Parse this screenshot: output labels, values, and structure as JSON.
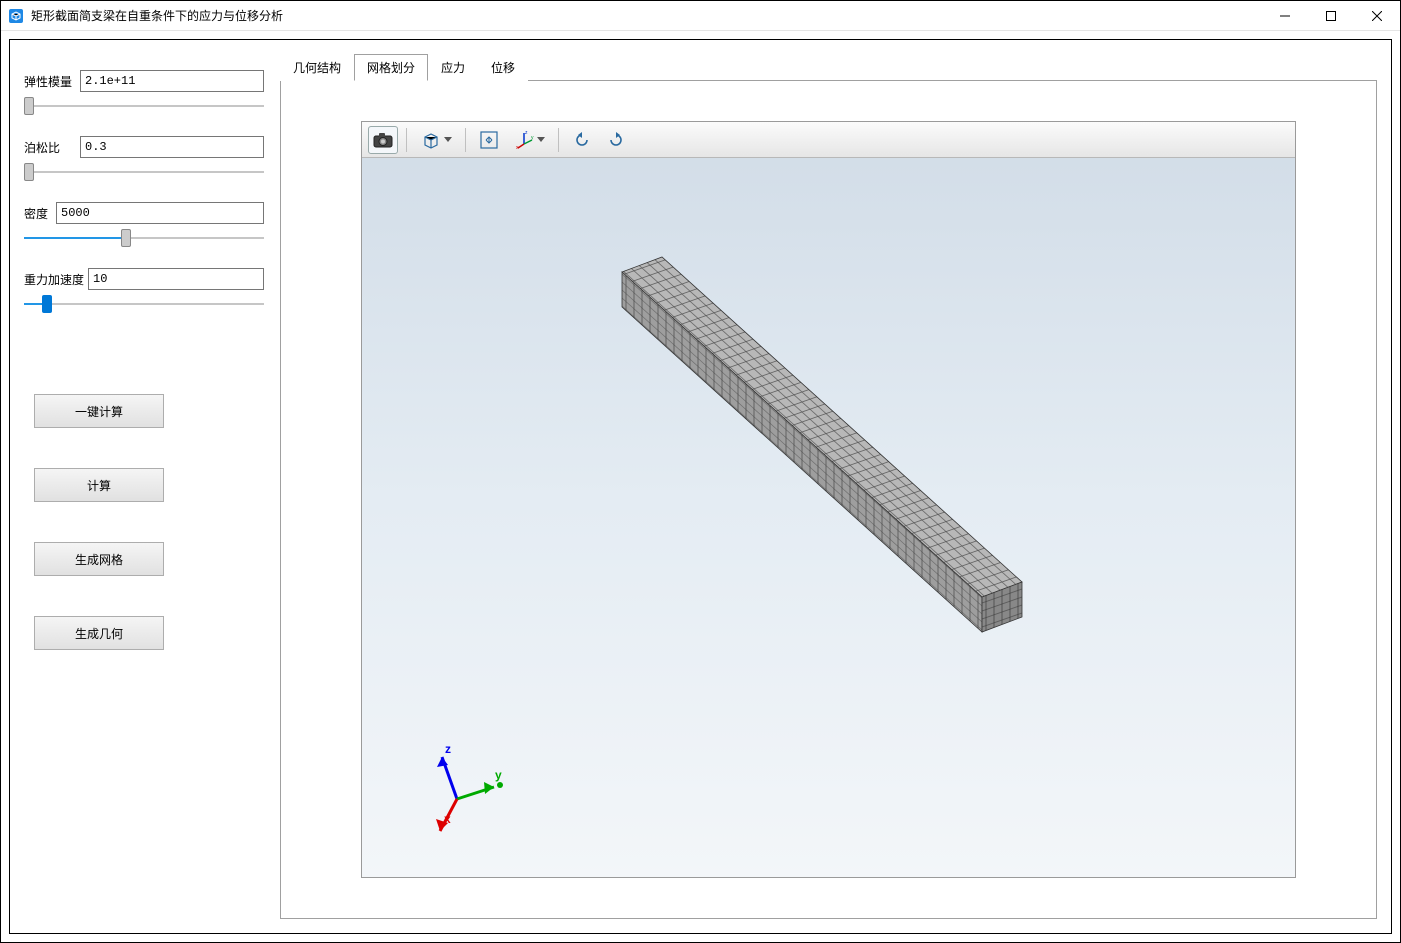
{
  "window": {
    "title": "矩形截面简支梁在自重条件下的应力与位移分析"
  },
  "params": {
    "elastic_modulus": {
      "label": "弹性模量",
      "value": "2.1e+11",
      "slider_pct": 0
    },
    "poisson_ratio": {
      "label": "泊松比",
      "value": "0.3",
      "slider_pct": 0
    },
    "density": {
      "label": "密度",
      "value": "5000",
      "slider_pct": 42
    },
    "gravity": {
      "label": "重力加速度",
      "value": "10",
      "slider_pct": 8
    }
  },
  "buttons": {
    "one_click_calc": "一键计算",
    "calc": "计算",
    "gen_mesh": "生成网格",
    "gen_geom": "生成几何"
  },
  "tabs": {
    "geometry": "几何结构",
    "mesh": "网格划分",
    "stress": "应力",
    "displacement": "位移",
    "active": "mesh"
  },
  "viewport_toolbar": {
    "camera": "camera-icon",
    "box_view": "box-view-icon",
    "fit": "fit-view-icon",
    "axes": "axes-selector-icon",
    "rotate_ccw": "rotate-ccw-icon",
    "rotate_cw": "rotate-cw-icon"
  },
  "triad": {
    "x": "x",
    "y": "y",
    "z": "z"
  }
}
